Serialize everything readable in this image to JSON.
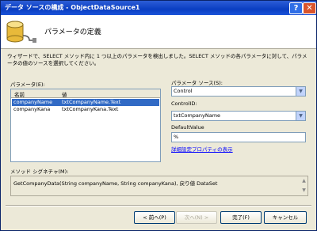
{
  "window": {
    "title": "データ ソースの構成 - ObjectDataSource1",
    "help_label": "?",
    "close_label": "✕"
  },
  "header": {
    "title": "パラメータの定義"
  },
  "description": "ウィザードで、SELECT メソッド内に 1 つ以上のパラメータを検出しました。SELECT メソッドの各パラメータに対して、パラメータの値のソースを選択してください。",
  "parameters": {
    "label": "パラメータ(E):",
    "columns": [
      "名前",
      "値"
    ],
    "rows": [
      {
        "name": "companyName",
        "value": "txtCompanyName.Text",
        "selected": true
      },
      {
        "name": "companyKana",
        "value": "txtCompanyKana.Text",
        "selected": false
      }
    ]
  },
  "source": {
    "label": "パラメータ ソース(S):",
    "value": "Control"
  },
  "control_id": {
    "label": "ControlID:",
    "value": "txtCompanyName"
  },
  "default_value": {
    "label": "DefaultValue",
    "value": "%"
  },
  "advanced_link": "詳細設定プロパティの表示",
  "signature": {
    "label": "メソッド シグネチャ(M):",
    "value": "GetCompanyData(String companyName, String companyKana), 戻り値 DataSet"
  },
  "buttons": {
    "prev": "< 前へ(P)",
    "next": "次へ(N) >",
    "finish": "完了(F)",
    "cancel": "キャンセル"
  }
}
